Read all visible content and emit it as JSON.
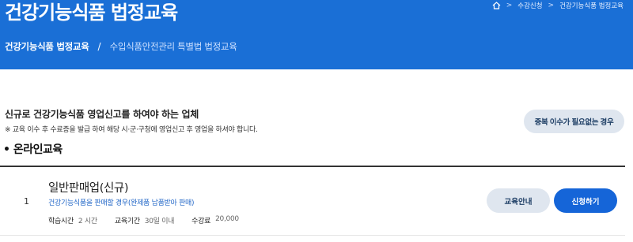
{
  "header": {
    "title": "건강기능식품 법정교육",
    "breadcrumb": {
      "home_icon": "home-icon",
      "items": [
        "수강신청",
        "건강기능식품 법정교육"
      ]
    },
    "subnav": {
      "active": "건강기능식품 법정교육",
      "separator": "/",
      "inactive": "수입식품안전관리 특별법 법정교육"
    }
  },
  "intro": {
    "heading": "신규로 건강기능식품 영업신고를 하여야 하는 업체",
    "note": "※ 교육 이수 후 수료증을 발급 하여 해당 시·군·구청에 영업신고 후 영업을 하셔야 합니다.",
    "exempt_button": "중복 이수가 필요없는 경우"
  },
  "section": {
    "title": "• 온라인교육"
  },
  "courses": [
    {
      "number": "1",
      "title": "일반판매업(신규)",
      "description": "건강기능식품을 판매할 경우(완제품 납품받아 판매)",
      "hours_label": "학습시간",
      "hours_value": "2 시간",
      "period_label": "교육기간",
      "period_value": "30일 이내",
      "fee_label": "수강료",
      "fee_value": "20,000",
      "info_button": "교육안내",
      "apply_button": "신청하기"
    }
  ],
  "colors": {
    "brand": "#1a6fd6",
    "primary_button": "#1565d8",
    "secondary_button": "#dfe6ef",
    "link_text": "#2468c8"
  }
}
